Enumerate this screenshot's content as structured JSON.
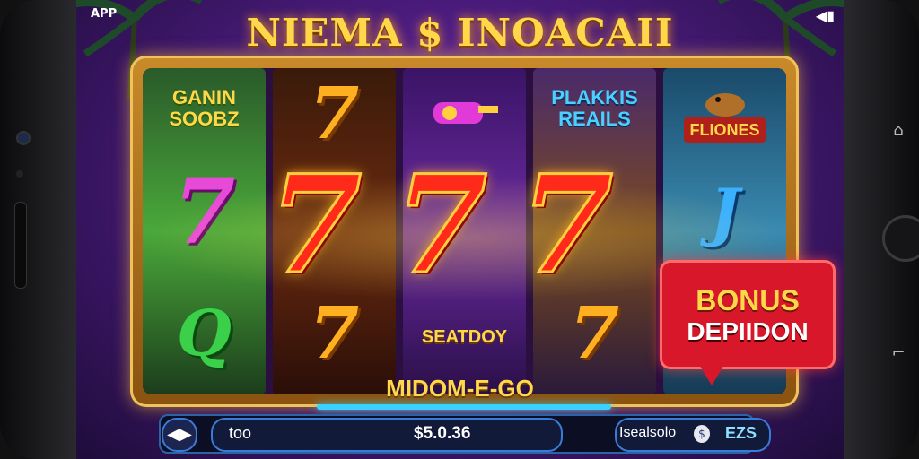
{
  "status_bar": {
    "app_label": "APP",
    "right_icon": "sound-icon"
  },
  "game": {
    "title": "NIEMA $ INOACAII",
    "subtitle": "MIDOM-E-GO",
    "reels": [
      {
        "top": "GANIN SOOBZ",
        "mid": "7",
        "bottom": "Q",
        "color": "#e84ad8"
      },
      {
        "top": "7",
        "mid": "7",
        "bottom": "7"
      },
      {
        "top": "",
        "mid": "7",
        "bottom": "SEATDOY"
      },
      {
        "top": "PLAKKIS REAILS",
        "mid": "7",
        "bottom": "7"
      },
      {
        "top": "FLIONES",
        "mid": "J",
        "bottom": ""
      }
    ],
    "win_symbols": [
      "7",
      "7",
      "7"
    ]
  },
  "bonus": {
    "line1": "BONUS",
    "line2": "DEPIIDON"
  },
  "controls": {
    "bet_value": "too",
    "balance": "$5.0.36",
    "right_label": "Isealsolo",
    "right_value": "EZS",
    "play_icon": "play-pause-icon",
    "coin_icon": "coin-icon"
  },
  "colors": {
    "accent": "#ffd84a",
    "bonus_bg": "#d8182a",
    "frame": "#c98a2a",
    "ui_border": "#3a7ad8"
  }
}
